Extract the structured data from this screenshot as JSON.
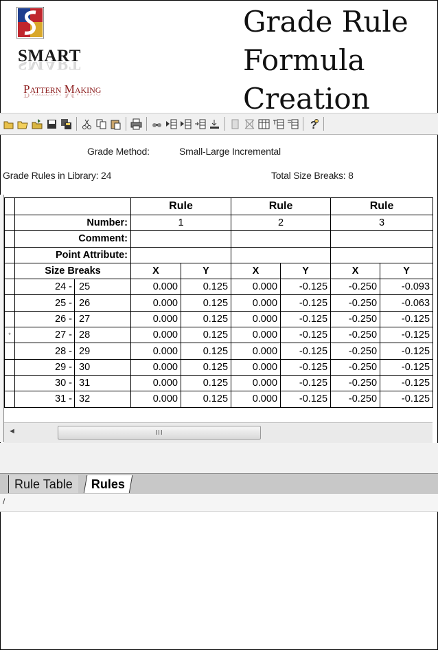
{
  "header": {
    "logo_line1": "SMART",
    "logo_line2": "Pattern Making",
    "heading_lines": [
      "Grade Rule",
      "Formula",
      "Creation"
    ]
  },
  "toolbar": {
    "icons": [
      "new-rule-icon",
      "open-icon",
      "open-library-icon",
      "save-icon",
      "save-all-icon",
      "cut-icon",
      "copy-icon",
      "paste-icon",
      "print-icon",
      "find-icon",
      "insert-before-icon",
      "insert-after-icon",
      "append-icon",
      "move-down-icon",
      "blank-icon",
      "delete-icon",
      "properties-icon",
      "options-icon",
      "export-icon",
      "help-icon"
    ]
  },
  "info": {
    "grade_method_label": "Grade Method:",
    "grade_method_value": "Small-Large Incremental",
    "rules_in_library": "Grade Rules in Library: 24",
    "total_size_breaks": "Total Size Breaks: 8"
  },
  "table": {
    "rule_header": "Rule",
    "number_label": "Number:",
    "comment_label": "Comment:",
    "point_attribute_label": "Point Attribute:",
    "size_breaks_label": "Size Breaks",
    "x_label": "X",
    "y_label": "Y",
    "rule_numbers": [
      "1",
      "2",
      "3"
    ],
    "current_row_marker": "*",
    "rows": [
      {
        "from": "24 -",
        "to": "25",
        "marker": "",
        "vals": [
          "0.000",
          "0.125",
          "0.000",
          "-0.125",
          "-0.250",
          "-0.093"
        ]
      },
      {
        "from": "25 -",
        "to": "26",
        "marker": "",
        "vals": [
          "0.000",
          "0.125",
          "0.000",
          "-0.125",
          "-0.250",
          "-0.063"
        ]
      },
      {
        "from": "26 -",
        "to": "27",
        "marker": "",
        "vals": [
          "0.000",
          "0.125",
          "0.000",
          "-0.125",
          "-0.250",
          "-0.125"
        ]
      },
      {
        "from": "27 -",
        "to": "28",
        "marker": "*",
        "vals": [
          "0.000",
          "0.125",
          "0.000",
          "-0.125",
          "-0.250",
          "-0.125"
        ]
      },
      {
        "from": "28 -",
        "to": "29",
        "marker": "",
        "vals": [
          "0.000",
          "0.125",
          "0.000",
          "-0.125",
          "-0.250",
          "-0.125"
        ]
      },
      {
        "from": "29 -",
        "to": "30",
        "marker": "",
        "vals": [
          "0.000",
          "0.125",
          "0.000",
          "-0.125",
          "-0.250",
          "-0.125"
        ]
      },
      {
        "from": "30 -",
        "to": "31",
        "marker": "",
        "vals": [
          "0.000",
          "0.125",
          "0.000",
          "-0.125",
          "-0.250",
          "-0.125"
        ]
      },
      {
        "from": "31 -",
        "to": "32",
        "marker": "",
        "vals": [
          "0.000",
          "0.125",
          "0.000",
          "-0.125",
          "-0.250",
          "-0.125"
        ]
      }
    ]
  },
  "scrollbar": {
    "left_arrow": "◄",
    "grip": "III"
  },
  "tabs": {
    "rule_table": "Rule Table",
    "rules": "Rules"
  },
  "status": {
    "text": "/"
  },
  "colors": {
    "logo_red": "#c0262d",
    "logo_blue": "#1f3f8f",
    "logo_gold": "#d9a82b"
  }
}
